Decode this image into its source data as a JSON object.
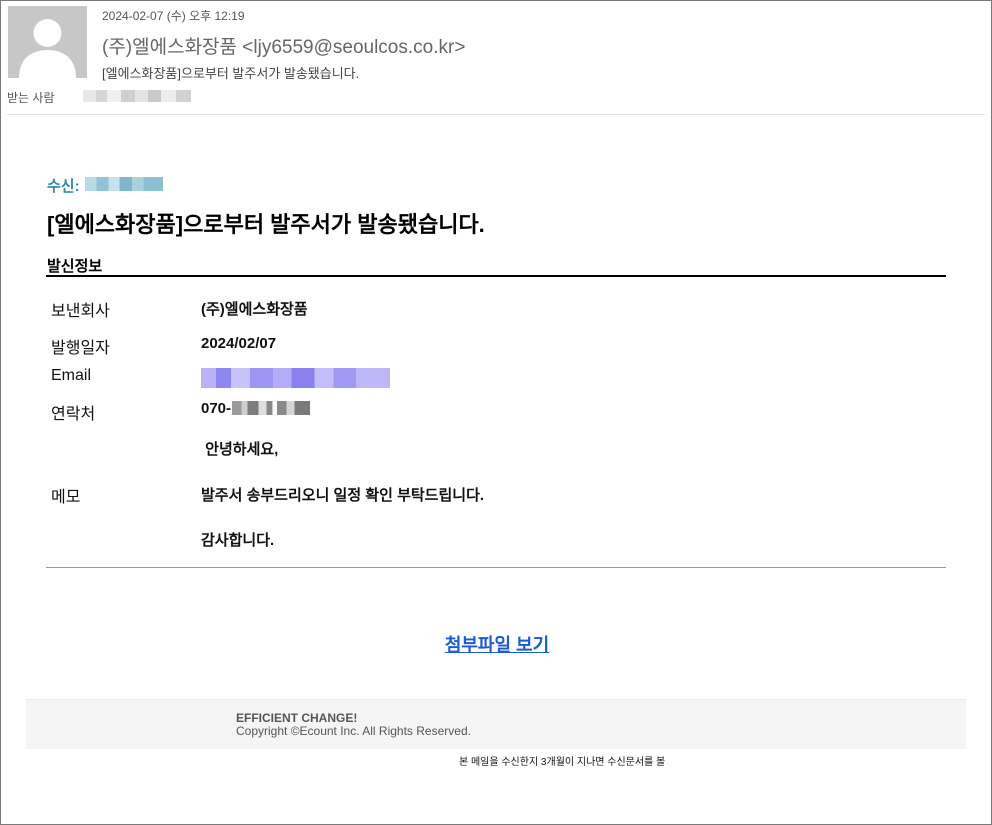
{
  "header": {
    "date": "2024-02-07 (수) 오후 12:19",
    "sender_name": "(주)엘에스화장품",
    "sender_email": "<ljy6559@seoulcos.co.kr>",
    "subject": "[엘에스화장품]으로부터 발주서가 발송됐습니다.",
    "to_label": "받는 사람"
  },
  "body": {
    "recipient_label": "수신:",
    "headline": "[엘에스화장품]으로부터 발주서가 발송됐습니다.",
    "section_title": "발신정보",
    "fields": {
      "company_label": "보낸회사",
      "company_value": "(주)엘에스화장품",
      "date_label": "발행일자",
      "date_value": "2024/02/07",
      "email_label": "Email",
      "phone_label": "연락처",
      "phone_prefix": "070-",
      "memo_label": "메모"
    },
    "memo_lines": [
      " 안녕하세요,",
      "발주서 송부드리오니 일정 확인 부탁드립니다.",
      "감사합니다."
    ],
    "attachment_link": "첨부파일 보기"
  },
  "footer": {
    "tagline": "EFFICIENT CHANGE!",
    "copyright": "Copyright ©Ecount Inc. All Rights Reserved.",
    "notice": "본 메일을 수신한지 3개월이 지나면 수신문서를 볼"
  },
  "colors": {
    "recipient_accent": "#2a8ba3",
    "link": "#1a5bd6"
  }
}
